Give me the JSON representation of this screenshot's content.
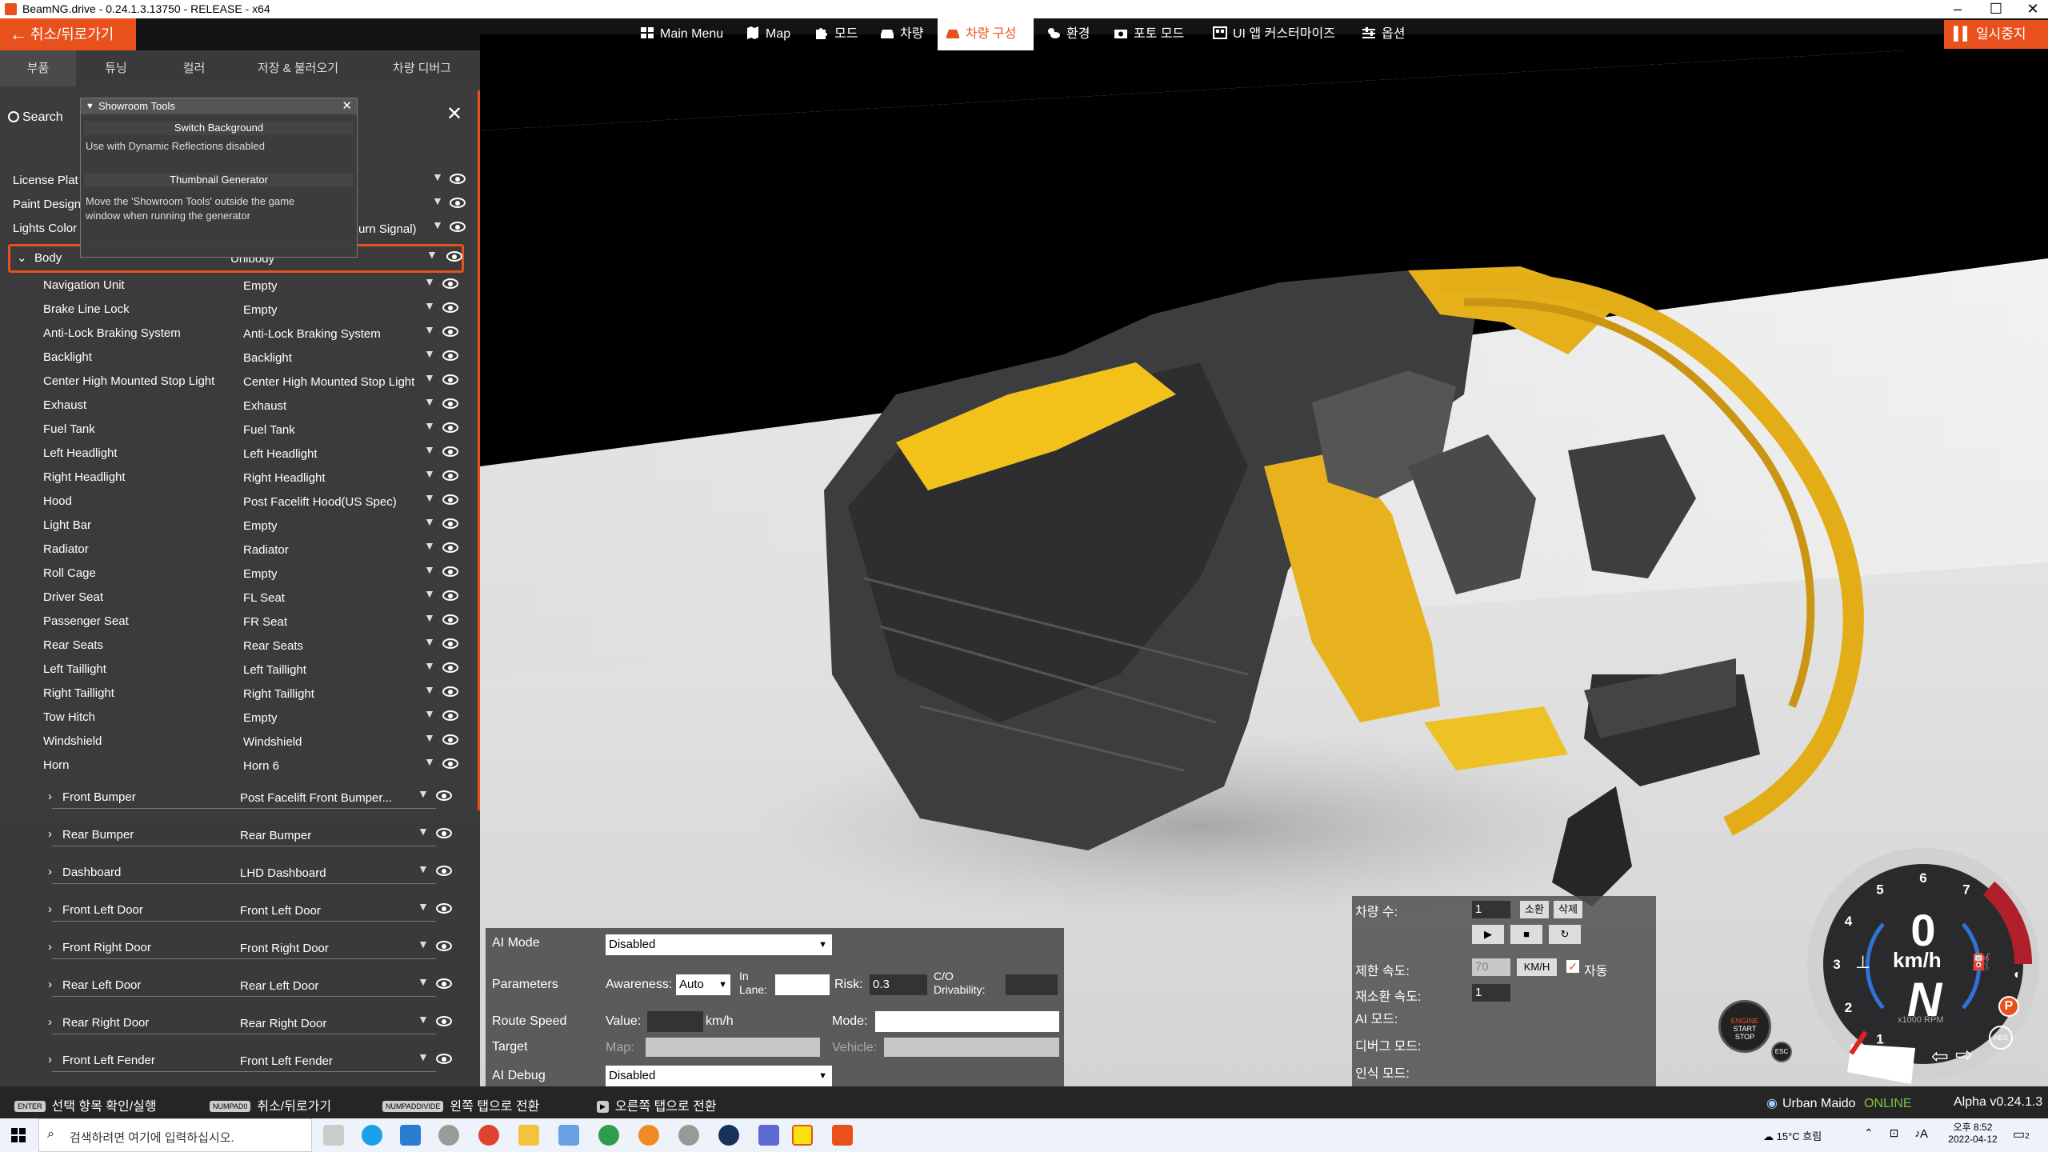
{
  "window": {
    "title": "BeamNG.drive - 0.24.1.3.13750 - RELEASE - x64"
  },
  "menu": {
    "back_label": "취소/뒤로가기",
    "items": [
      {
        "label": "Main Menu",
        "icon": "grid-icon"
      },
      {
        "label": "Map",
        "icon": "map-icon"
      },
      {
        "label": "모드",
        "icon": "puzzle-icon"
      },
      {
        "label": "차량",
        "icon": "car-icon"
      },
      {
        "label": "차량 구성",
        "icon": "vehicle-config-icon",
        "active": true
      },
      {
        "label": "환경",
        "icon": "weather-icon"
      },
      {
        "label": "포토 모드",
        "icon": "camera-icon"
      },
      {
        "label": "UI 앱 커스터마이즈",
        "icon": "apps-icon"
      },
      {
        "label": "옵션",
        "icon": "sliders-icon"
      }
    ],
    "pause_label": "일시중지"
  },
  "subtabs": [
    "부품",
    "튜닝",
    "컬러",
    "저장 & 불러오기",
    "차량 디버그"
  ],
  "search_label": "Search",
  "showroom": {
    "title": "Showroom Tools",
    "switch_background": "Switch Background",
    "switch_note": "Use with Dynamic Reflections disabled",
    "thumbnail_generator": "Thumbnail Generator",
    "thumbnail_note": "Move the 'Showroom Tools' outside the game window when running the generator"
  },
  "top_rows": [
    {
      "label": "License Plat",
      "value": ""
    },
    {
      "label": "Paint Design",
      "value": ""
    },
    {
      "label": "Lights Color",
      "value": "urn Signal)"
    }
  ],
  "body_row": {
    "label": "Body",
    "value": "Unibody"
  },
  "parts": [
    {
      "label": "Navigation Unit",
      "value": "Empty"
    },
    {
      "label": "Brake Line Lock",
      "value": "Empty"
    },
    {
      "label": "Anti-Lock Braking System",
      "value": "Anti-Lock Braking System"
    },
    {
      "label": "Backlight",
      "value": "Backlight"
    },
    {
      "label": "Center High Mounted Stop Light",
      "value": "Center High Mounted Stop Light"
    },
    {
      "label": "Exhaust",
      "value": "Exhaust"
    },
    {
      "label": "Fuel Tank",
      "value": "Fuel Tank"
    },
    {
      "label": "Left Headlight",
      "value": "Left Headlight"
    },
    {
      "label": "Right Headlight",
      "value": "Right Headlight"
    },
    {
      "label": "Hood",
      "value": "Post Facelift Hood(US Spec)"
    },
    {
      "label": "Light Bar",
      "value": "Empty"
    },
    {
      "label": "Radiator",
      "value": "Radiator"
    },
    {
      "label": "Roll Cage",
      "value": "Empty"
    },
    {
      "label": "Driver Seat",
      "value": "FL Seat"
    },
    {
      "label": "Passenger Seat",
      "value": "FR Seat"
    },
    {
      "label": "Rear Seats",
      "value": "Rear Seats"
    },
    {
      "label": "Left Taillight",
      "value": "Left Taillight"
    },
    {
      "label": "Right Taillight",
      "value": "Right Taillight"
    },
    {
      "label": "Tow Hitch",
      "value": "Empty"
    },
    {
      "label": "Windshield",
      "value": "Windshield"
    },
    {
      "label": "Horn",
      "value": "Horn 6"
    }
  ],
  "groups": [
    {
      "label": "Front Bumper",
      "value": "Post Facelift Front Bumper..."
    },
    {
      "label": "Rear Bumper",
      "value": "Rear Bumper"
    },
    {
      "label": "Dashboard",
      "value": "LHD Dashboard"
    },
    {
      "label": "Front Left Door",
      "value": "Front Left Door"
    },
    {
      "label": "Front Right Door",
      "value": "Front Right Door"
    },
    {
      "label": "Rear Left Door",
      "value": "Rear Left Door"
    },
    {
      "label": "Rear Right Door",
      "value": "Rear Right Door"
    },
    {
      "label": "Front Left Fender",
      "value": "Front Left Fender"
    }
  ],
  "ai": {
    "mode_label": "AI Mode",
    "mode_value": "Disabled",
    "params_label": "Parameters",
    "awareness_label": "Awareness:",
    "awareness_value": "Auto",
    "in_lane_label": "In Lane:",
    "risk_label": "Risk:",
    "risk_value": "0.3",
    "drivability_label": "C/O Drivability:",
    "route_label": "Route Speed",
    "value_label": "Value:",
    "kmh": "km/h",
    "mode2_label": "Mode:",
    "target_label": "Target",
    "map_label": "Map:",
    "vehicle_label": "Vehicle:",
    "debug_label": "AI Debug",
    "debug_value": "Disabled"
  },
  "spawn": {
    "count_label": "차량 수:",
    "count_value": "1",
    "spawn_btn": "소환",
    "delete_btn": "삭제",
    "speed_label": "제한 속도:",
    "speed_value": "70",
    "unit_btn": "KM/H",
    "auto_label": "자동",
    "respawn_label": "재소환 속도:",
    "respawn_value": "1",
    "ai_mode_label": "AI 모드:",
    "debug_mode_label": "디버그 모드:",
    "recognition_label": "인식 모드:"
  },
  "gauge": {
    "speed": "0",
    "unit": "km/h",
    "gear": "N",
    "rpm_label": "x1000 RPM",
    "ticks": [
      "1",
      "2",
      "3",
      "4",
      "5",
      "6",
      "7"
    ],
    "gear_p": "P",
    "abs": "ABS"
  },
  "engine_btn": {
    "line1": "ENGINE",
    "line2": "START",
    "line3": "STOP",
    "esc": "ESC"
  },
  "bottombar": {
    "hints": [
      {
        "key": "ENTER",
        "text": "선택 항목 확인/실행"
      },
      {
        "key": "NUMPAD0",
        "text": "취소/뒤로가기"
      },
      {
        "key": "NUMPADDIVIDE",
        "text": "왼쪽 탭으로 전환"
      },
      {
        "key": "▶",
        "text": "오른쪽 탭으로 전환"
      }
    ],
    "user": "Urban Maido",
    "status": "ONLINE",
    "version": "Alpha v0.24.1.3"
  },
  "taskbar": {
    "search_placeholder": "검색하려면 여기에 입력하십시오.",
    "weather": "15°C 흐림",
    "time": "오후 8:52",
    "date": "2022-04-12",
    "notif_count": "2",
    "ime": "A"
  },
  "colors": {
    "accent": "#e9511c",
    "online": "#7fc241"
  }
}
